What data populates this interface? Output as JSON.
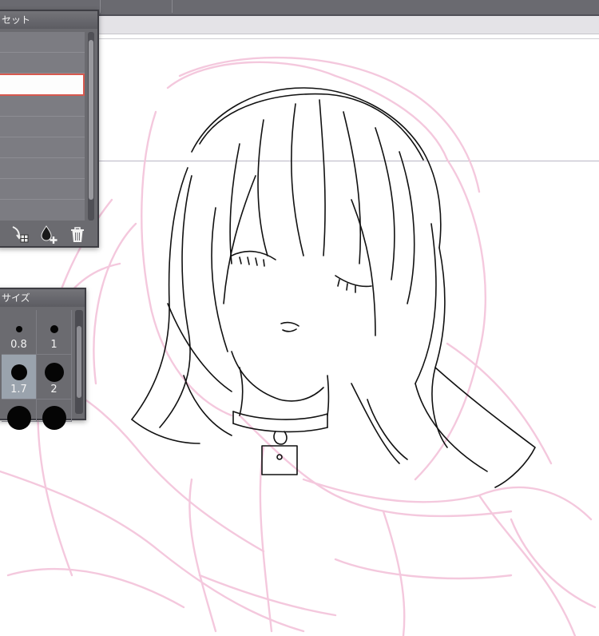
{
  "header": {
    "left_text": ""
  },
  "preset_panel": {
    "title": "セット",
    "selected_index": 2,
    "tools": [
      {
        "icon": "copy-preset-icon"
      },
      {
        "icon": "add-color-icon"
      },
      {
        "icon": "trash-icon"
      }
    ]
  },
  "size_panel": {
    "title": "サイズ",
    "sizes": [
      {
        "label": "0.8",
        "selected": false
      },
      {
        "label": "1",
        "selected": false
      },
      {
        "label": "1.7",
        "selected": true
      },
      {
        "label": "2",
        "selected": false
      },
      {
        "label": "",
        "selected": false
      },
      {
        "label": "",
        "selected": false
      }
    ]
  },
  "colors": {
    "accent_selection": "#d7584e",
    "sketch_pink": "#f4c6dc",
    "ink": "#111111",
    "panel_bg": "#6b6b70"
  }
}
